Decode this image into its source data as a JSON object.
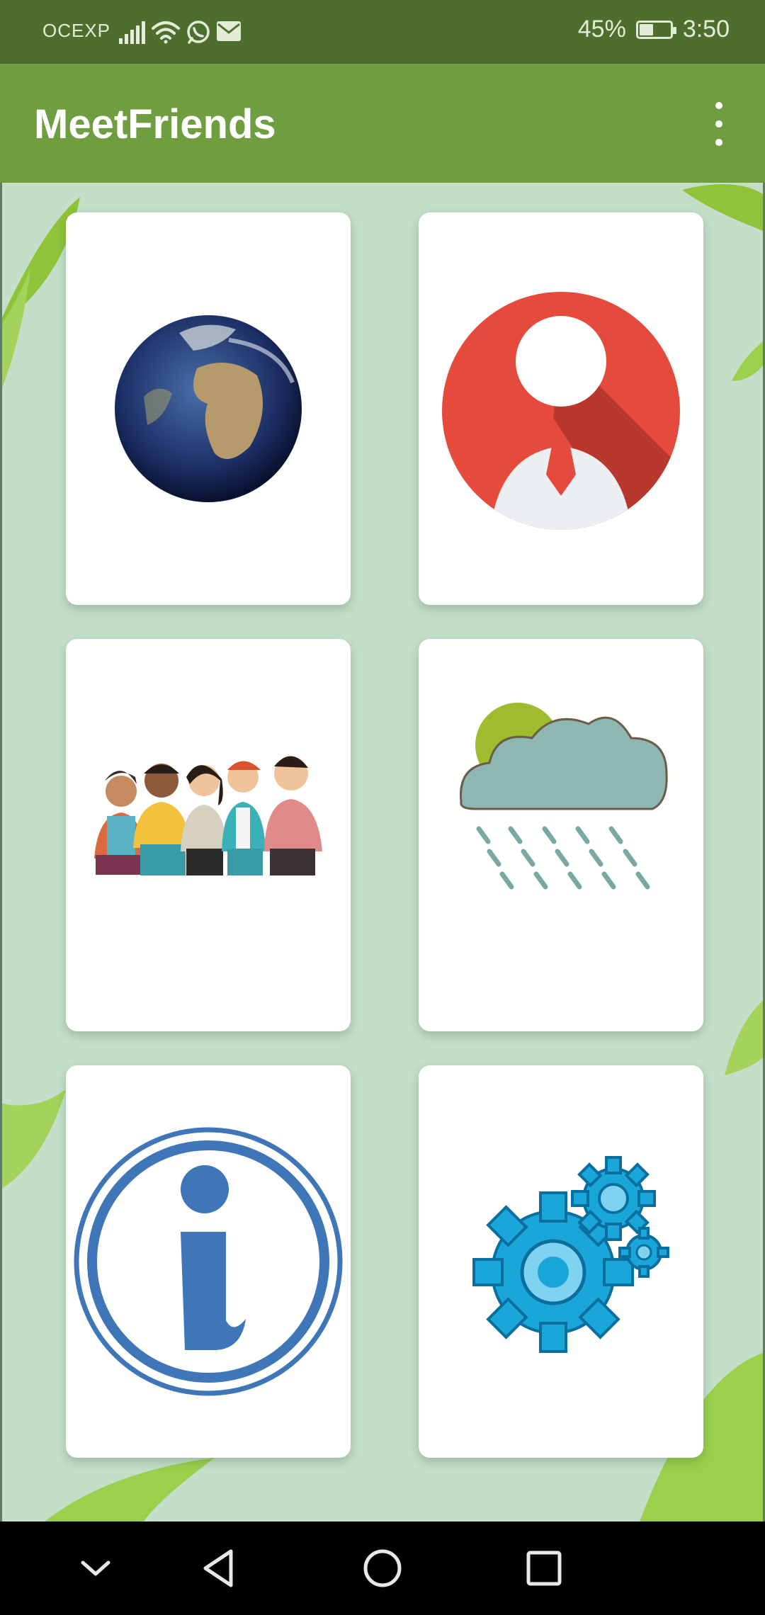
{
  "status_bar": {
    "carrier": "OCEXP",
    "battery_percent": "45%",
    "battery_level": 0.45,
    "time": "3:50",
    "icons": [
      "signal-icon",
      "wifi-icon",
      "whatsapp-icon",
      "mail-icon"
    ]
  },
  "app_bar": {
    "title": "MeetFriends",
    "menu_icon": "overflow-menu-icon"
  },
  "grid": {
    "cards": [
      {
        "icon": "globe-icon"
      },
      {
        "icon": "profile-icon"
      },
      {
        "icon": "friends-group-icon"
      },
      {
        "icon": "weather-icon"
      },
      {
        "icon": "info-icon"
      },
      {
        "icon": "settings-gears-icon"
      }
    ]
  },
  "nav_bar": {
    "buttons": [
      "collapse-icon",
      "back-icon",
      "home-icon",
      "recents-icon"
    ]
  },
  "colors": {
    "status_bar": "#4d6e2c",
    "app_bar": "#6f9e41",
    "background": "#c3dfc8",
    "profile_red": "#e54b3c",
    "info_blue": "#3f76b8",
    "gear_blue": "#1aa6d9"
  }
}
